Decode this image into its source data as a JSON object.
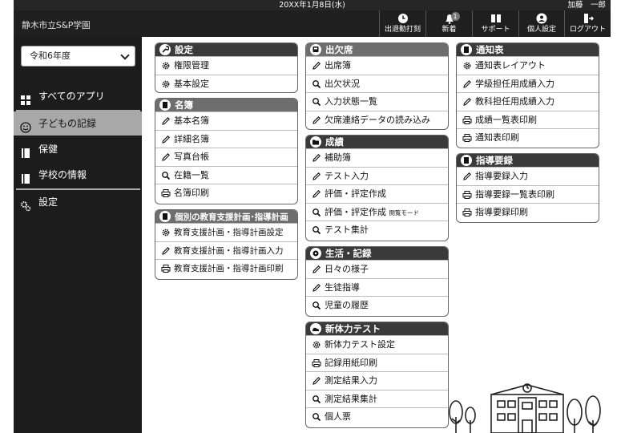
{
  "topbar": {
    "date": "20XX年1月8日(水)",
    "user": "加藤　一郎"
  },
  "header": {
    "school": "静木市立S&P学園",
    "buttons": [
      {
        "label": "出退勤打刻",
        "icon": "clock-icon"
      },
      {
        "label": "新着",
        "icon": "bell-icon",
        "badge": "1"
      },
      {
        "label": "サポート",
        "icon": "book-icon"
      },
      {
        "label": "個人設定",
        "icon": "person-icon"
      },
      {
        "label": "ログアウト",
        "icon": "logout-icon"
      }
    ]
  },
  "sidebar": {
    "year_select": "令和6年度",
    "items": [
      {
        "label": "すべてのアプリ",
        "icon": "grid-icon"
      },
      {
        "label": "子どもの記録",
        "icon": "smile-icon",
        "active": true
      },
      {
        "label": "保健",
        "icon": "notebook-icon"
      },
      {
        "label": "学校の情報",
        "icon": "notebook-icon"
      },
      {
        "label": "設定",
        "icon": "gears-icon"
      }
    ]
  },
  "cards": {
    "settings": {
      "title": "設定",
      "items": [
        "権限管理",
        "基本設定"
      ]
    },
    "roster": {
      "title": "名簿",
      "items": [
        "基本名簿",
        "詳細名簿",
        "写真台帳",
        "在籍一覧",
        "名簿印刷"
      ]
    },
    "support_plan": {
      "title": "個別の教育支援計画･指導計画",
      "items": [
        "教育支援計画・指導計画設定",
        "教育支援計画・指導計画入力",
        "教育支援計画・指導計画印刷"
      ]
    },
    "attendance": {
      "title": "出欠席",
      "items": [
        "出席簿",
        "出欠状況",
        "入力状態一覧",
        "欠席連絡データの読み込み"
      ]
    },
    "grades": {
      "title": "成績",
      "items": [
        "補助簿",
        "テスト入力",
        "評価・評定作成",
        "評価・評定作成",
        "テスト集計"
      ],
      "note": "閲覧モード"
    },
    "life": {
      "title": "生活・記録",
      "items": [
        "日々の様子",
        "生徒指導",
        "児童の履歴"
      ]
    },
    "fitness": {
      "title": "新体力テスト",
      "items": [
        "新体力テスト設定",
        "記録用紙印刷",
        "測定結果入力",
        "測定結果集計",
        "個人票"
      ]
    },
    "report": {
      "title": "通知表",
      "items": [
        "通知表レイアウト",
        "学級担任用成績入力",
        "教科担任用成績入力",
        "成績一覧表印刷",
        "通知表印刷"
      ]
    },
    "guidance": {
      "title": "指導要録",
      "items": [
        "指導要録入力",
        "指導要録一覧表印刷",
        "指導要録印刷"
      ]
    }
  },
  "colors": {
    "dark": "#1f1f1f",
    "active": "#a8a8a8",
    "card_header": "#3a3a3a",
    "card_header_grey": "#6e6e6e"
  }
}
